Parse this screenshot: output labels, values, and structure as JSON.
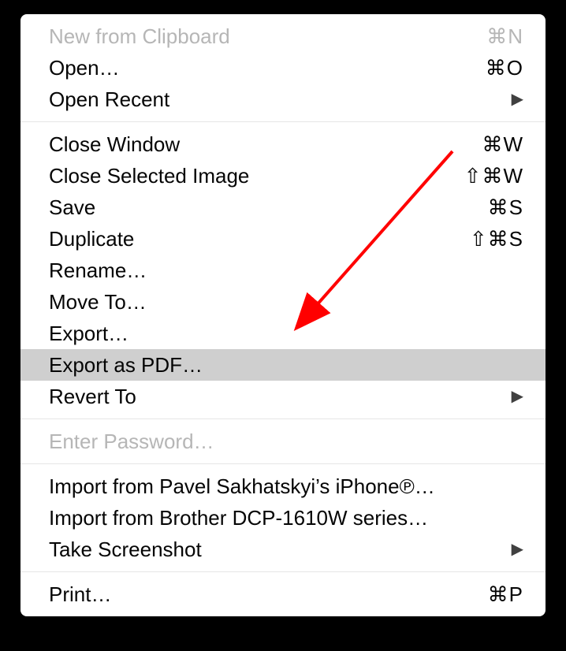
{
  "menu": {
    "groups": [
      [
        {
          "id": "new-from-clipboard",
          "label": "New from Clipboard",
          "shortcut": "⌘N",
          "disabled": true
        },
        {
          "id": "open",
          "label": "Open…",
          "shortcut": "⌘O"
        },
        {
          "id": "open-recent",
          "label": "Open Recent",
          "submenu": true
        }
      ],
      [
        {
          "id": "close-window",
          "label": "Close Window",
          "shortcut": "⌘W"
        },
        {
          "id": "close-selected-image",
          "label": "Close Selected Image",
          "shortcut": "⇧⌘W"
        },
        {
          "id": "save",
          "label": "Save",
          "shortcut": "⌘S"
        },
        {
          "id": "duplicate",
          "label": "Duplicate",
          "shortcut": "⇧⌘S"
        },
        {
          "id": "rename",
          "label": "Rename…"
        },
        {
          "id": "move-to",
          "label": "Move To…"
        },
        {
          "id": "export",
          "label": "Export…"
        },
        {
          "id": "export-as-pdf",
          "label": "Export as PDF…",
          "highlight": true
        },
        {
          "id": "revert-to",
          "label": "Revert To",
          "submenu": true
        }
      ],
      [
        {
          "id": "enter-password",
          "label": "Enter Password…",
          "disabled": true
        }
      ],
      [
        {
          "id": "import-from-iphone",
          "label": "Import from Pavel Sakhatskyi’s iPhone℗…"
        },
        {
          "id": "import-from-brother",
          "label": "Import from Brother DCP-1610W series…"
        },
        {
          "id": "take-screenshot",
          "label": "Take Screenshot",
          "submenu": true
        }
      ],
      [
        {
          "id": "print",
          "label": "Print…",
          "shortcut": "⌘P"
        }
      ]
    ]
  },
  "annotation": {
    "arrow_color": "#ff0000",
    "target": "export-as-pdf"
  }
}
